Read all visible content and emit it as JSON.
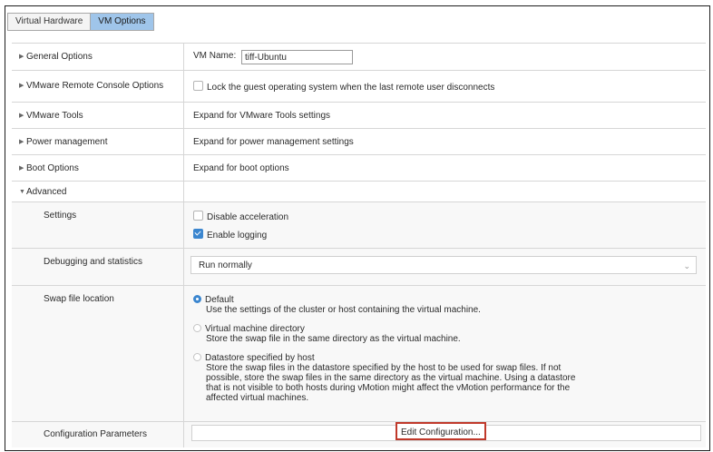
{
  "tabs": [
    {
      "label": "Virtual Hardware"
    },
    {
      "label": "VM Options"
    }
  ],
  "general_options": {
    "label": "General Options",
    "vm_name_label": "VM Name:",
    "vm_name_value": "tiff-Ubuntu"
  },
  "remote_console": {
    "label": "VMware Remote Console Options",
    "lock_label": "Lock the guest operating system when the last remote user disconnects",
    "lock_checked": false
  },
  "vmware_tools": {
    "label": "VMware Tools",
    "value": "Expand for VMware Tools settings"
  },
  "power_management": {
    "label": "Power management",
    "value": "Expand for power management settings"
  },
  "boot_options": {
    "label": "Boot Options",
    "value": "Expand for boot options"
  },
  "advanced": {
    "label": "Advanced",
    "settings": {
      "label": "Settings",
      "disable_acceleration": {
        "label": "Disable acceleration",
        "checked": false
      },
      "enable_logging": {
        "label": "Enable logging",
        "checked": true
      }
    },
    "debugging": {
      "label": "Debugging and statistics",
      "selected": "Run normally"
    },
    "swap": {
      "label": "Swap file location",
      "options": [
        {
          "title": "Default",
          "selected": true,
          "desc": [
            "Use the settings of the cluster or host containing the virtual machine."
          ]
        },
        {
          "title": "Virtual machine directory",
          "selected": false,
          "desc": [
            "Store the swap file in the same directory as the virtual machine."
          ]
        },
        {
          "title": "Datastore specified by host",
          "selected": false,
          "desc": [
            "Store the swap files in the datastore specified by the host to be used for swap files. If not",
            "possible, store the swap files in the same directory as the virtual machine. Using a datastore",
            "that is not visible to both hosts during vMotion might affect the vMotion performance for the",
            "affected virtual machines."
          ]
        }
      ]
    },
    "config_params": {
      "label": "Configuration Parameters",
      "button": "Edit Configuration..."
    }
  },
  "colors": {
    "accent": "#3b86cf",
    "tab_active": "#9fc5ea",
    "highlight_border": "#c0392b"
  }
}
